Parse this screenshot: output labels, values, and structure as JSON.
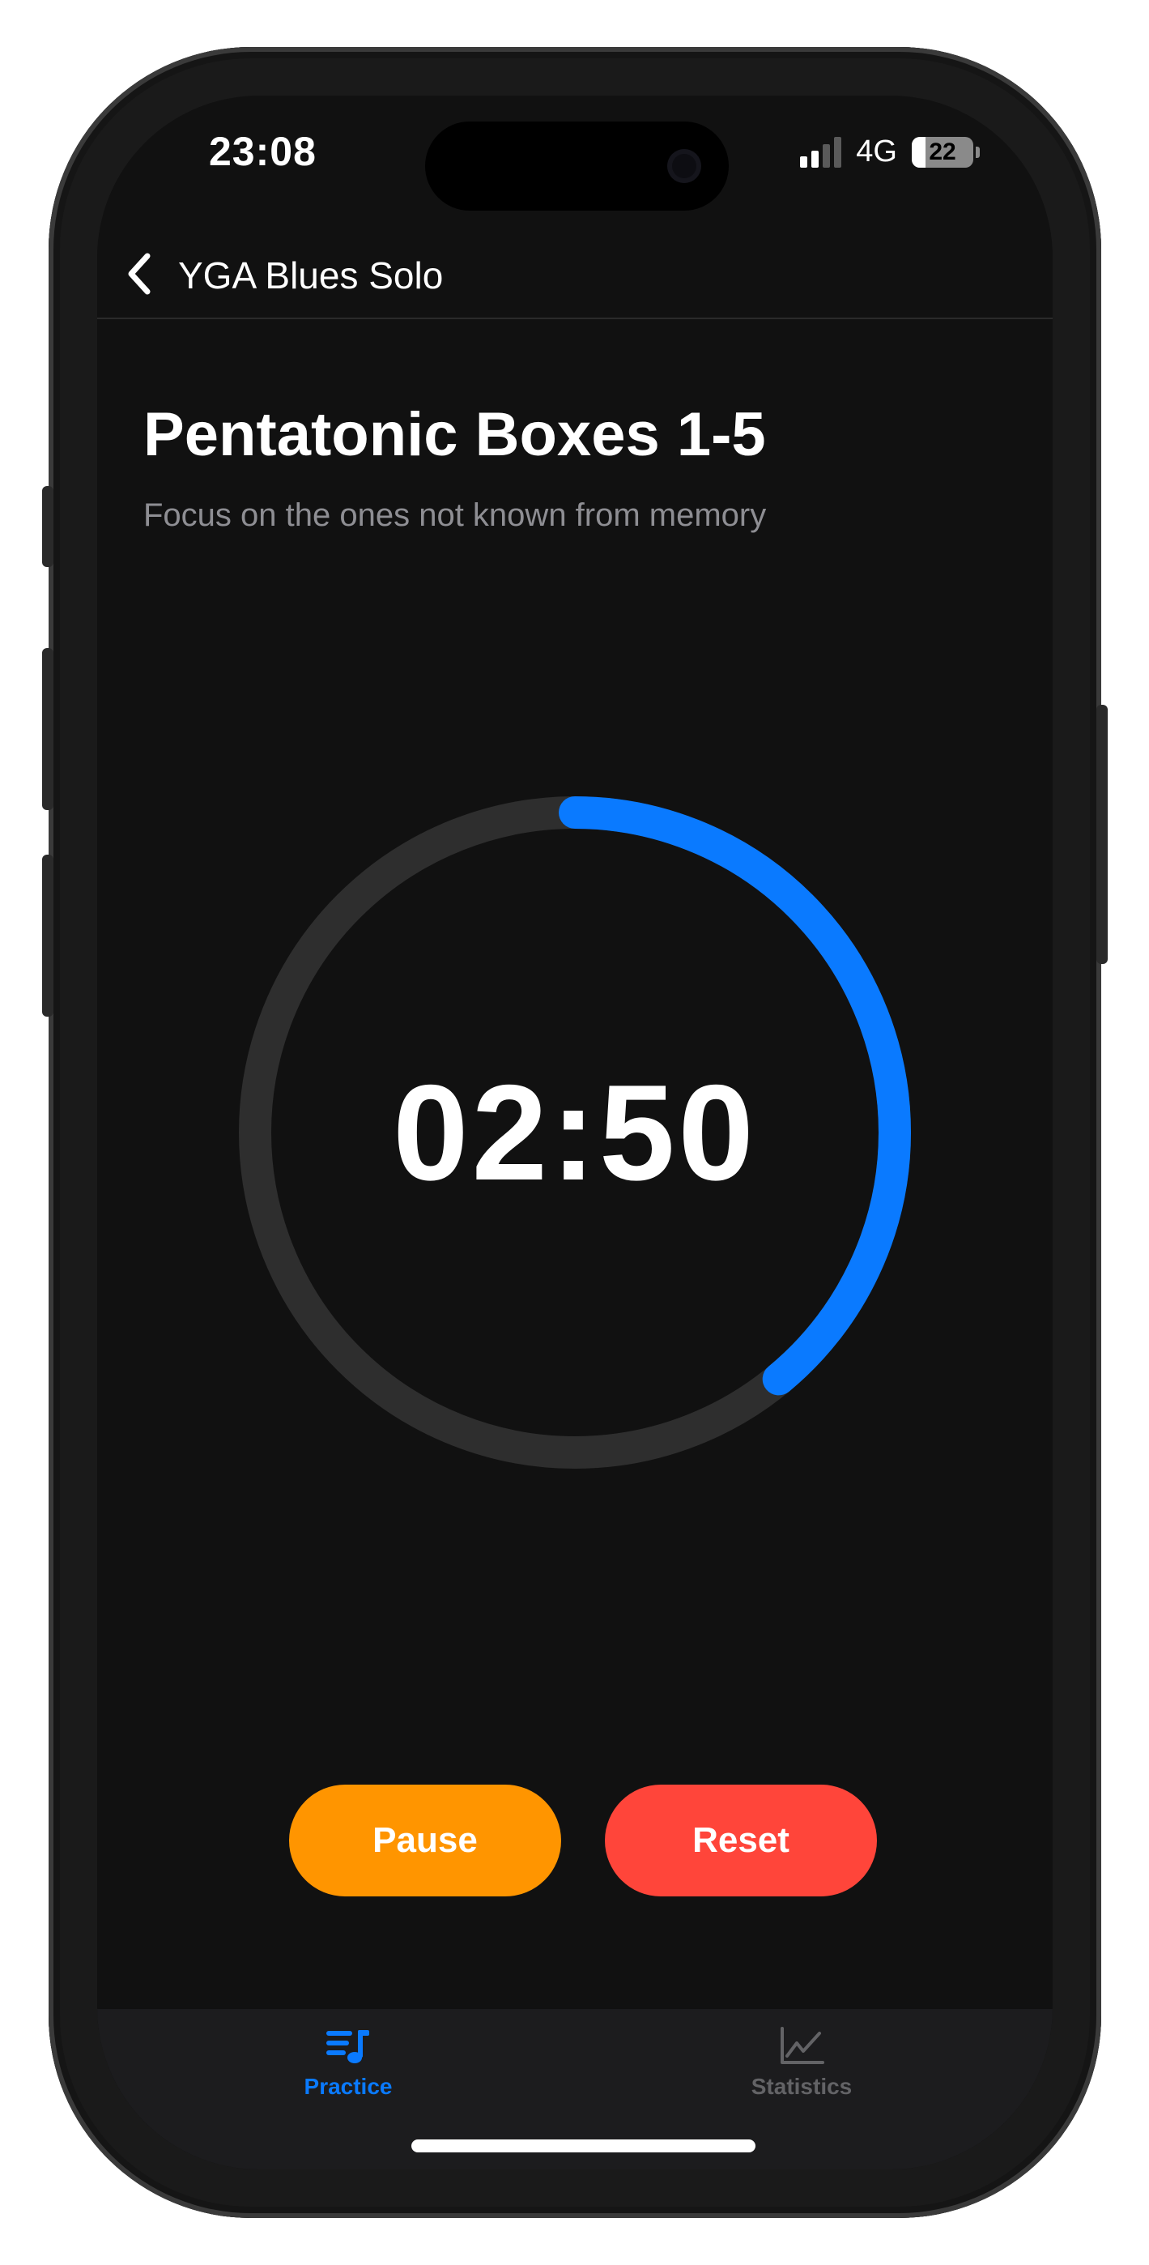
{
  "status_bar": {
    "time": "23:08",
    "network": "4G",
    "battery_level": "22",
    "battery_fraction": 0.22,
    "signal_bars_active": 2,
    "signal_bars_total": 4
  },
  "nav": {
    "back_label": "YGA Blues Solo"
  },
  "exercise": {
    "title": "Pentatonic Boxes 1-5",
    "subtitle": "Focus on the ones not known from memory"
  },
  "timer": {
    "display": "02:50",
    "progress_fraction": 0.39,
    "progress_color": "#0a7aff",
    "track_color": "#2e2e2e"
  },
  "controls": {
    "pause_label": "Pause",
    "pause_color": "#ff9500",
    "reset_label": "Reset",
    "reset_color": "#ff453a"
  },
  "tabs": [
    {
      "label": "Practice",
      "icon": "music-list-icon",
      "active": true
    },
    {
      "label": "Statistics",
      "icon": "chart-line-icon",
      "active": false
    }
  ],
  "colors": {
    "active_tab": "#0a7aff",
    "inactive_tab": "#636366"
  }
}
